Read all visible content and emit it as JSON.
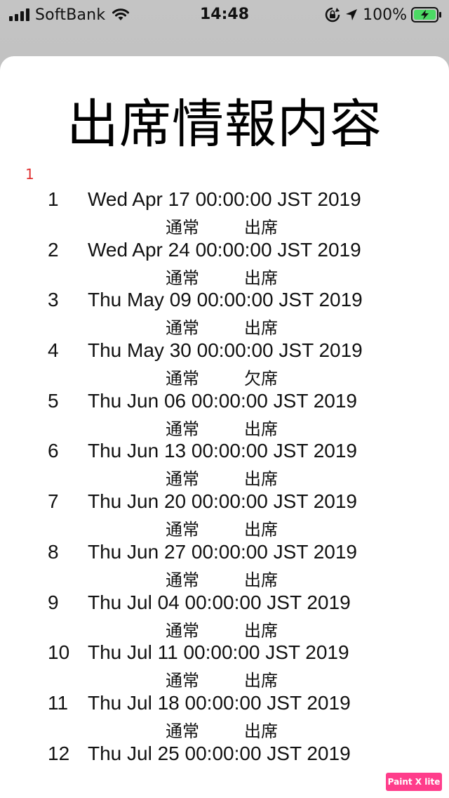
{
  "status_bar": {
    "carrier": "SoftBank",
    "time": "14:48",
    "battery_percent": "100%"
  },
  "header": {
    "title": "出席情報内容",
    "marker": "1"
  },
  "records": [
    {
      "num": "1",
      "date": "Wed Apr 17 00:00:00 JST 2019",
      "type": "通常",
      "status": "出席"
    },
    {
      "num": "2",
      "date": "Wed Apr 24 00:00:00 JST 2019",
      "type": "通常",
      "status": "出席"
    },
    {
      "num": "3",
      "date": "Thu May 09 00:00:00 JST 2019",
      "type": "通常",
      "status": "出席"
    },
    {
      "num": "4",
      "date": "Thu May 30 00:00:00 JST 2019",
      "type": "通常",
      "status": "欠席"
    },
    {
      "num": "5",
      "date": "Thu Jun 06 00:00:00 JST 2019",
      "type": "通常",
      "status": "出席"
    },
    {
      "num": "6",
      "date": "Thu Jun 13 00:00:00 JST 2019",
      "type": "通常",
      "status": "出席"
    },
    {
      "num": "7",
      "date": "Thu Jun 20 00:00:00 JST 2019",
      "type": "通常",
      "status": "出席"
    },
    {
      "num": "8",
      "date": "Thu Jun 27 00:00:00 JST 2019",
      "type": "通常",
      "status": "出席"
    },
    {
      "num": "9",
      "date": "Thu Jul 04 00:00:00 JST 2019",
      "type": "通常",
      "status": "出席"
    },
    {
      "num": "10",
      "date": "Thu Jul 11 00:00:00 JST 2019",
      "type": "通常",
      "status": "出席"
    },
    {
      "num": "11",
      "date": "Thu Jul 18 00:00:00 JST 2019",
      "type": "通常",
      "status": "出席"
    },
    {
      "num": "12",
      "date": "Thu Jul 25 00:00:00 JST 2019",
      "type": "",
      "status": ""
    }
  ],
  "watermark": "Paint X lite",
  "colors": {
    "marker": "#e03030",
    "battery_fill": "#4cd964",
    "watermark_bg": "#ff3d8b"
  }
}
